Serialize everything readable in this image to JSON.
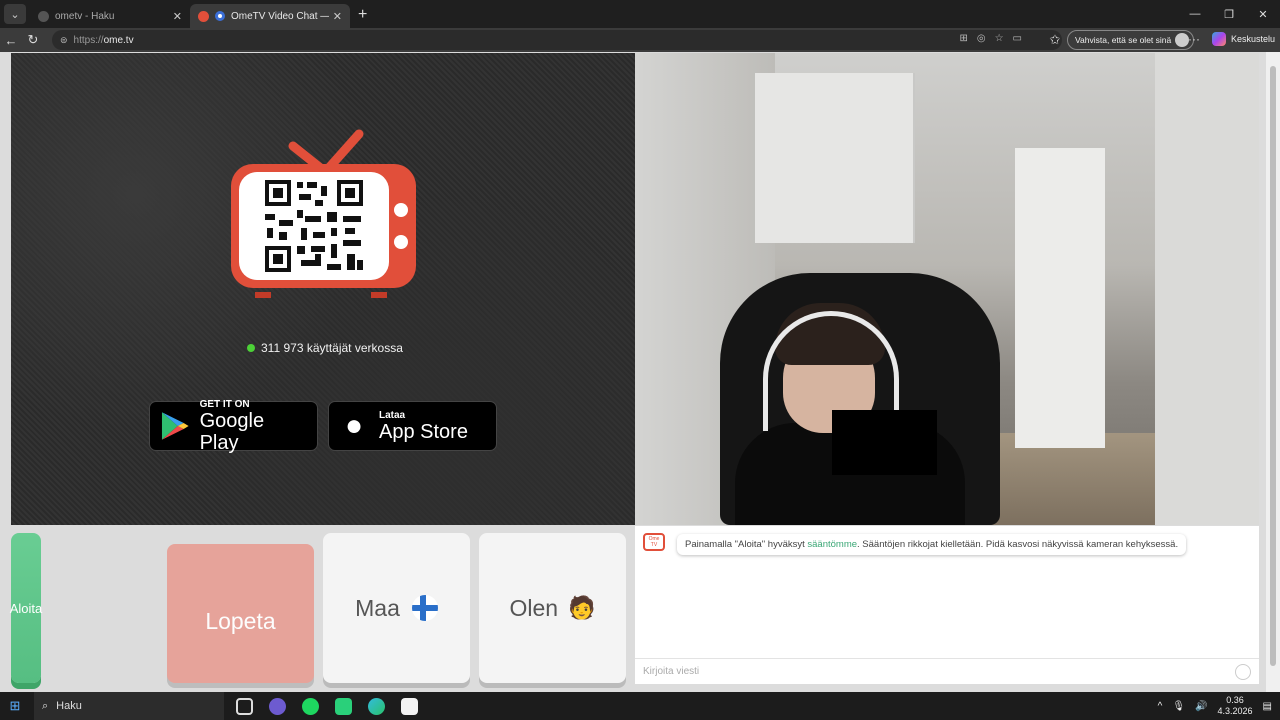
{
  "browser": {
    "tabs": [
      {
        "title": "ometv - Haku",
        "active": false
      },
      {
        "title": "OmeTV Video Chat — Omegl",
        "active": true
      }
    ],
    "new_tab": "+",
    "url_prefix": "https://",
    "url_domain": "ome.tv",
    "verify_label": "Vahvista, että se olet sinä",
    "copilot_label": "Keskustelu"
  },
  "page": {
    "online_count": "311 973 käyttäjät verkossa",
    "google_play": {
      "small": "GET IT ON",
      "big": "Google Play"
    },
    "app_store": {
      "small": "Lataa",
      "big": "App Store"
    },
    "buttons": {
      "start": "Aloita",
      "stop": "Lopeta",
      "country": "Maa",
      "gender": "Olen",
      "gender_emoji": "🧑"
    },
    "chat": {
      "logo": "Ome TV",
      "message_before": "Painamalla \"Aloita\" hyväksyt ",
      "message_link": "sääntömme",
      "message_after": ". Sääntöjen rikkojat kielletään. Pidä kasvosi näkyvissä kameran kehyksessä.",
      "input_placeholder": "Kirjoita viesti"
    }
  },
  "taskbar": {
    "search_label": "Haku",
    "time": "0.36",
    "date": "4.3.2026"
  },
  "colors": {
    "start": "#5ec488",
    "stop": "#e7a197",
    "tv_red": "#e14f3a"
  }
}
